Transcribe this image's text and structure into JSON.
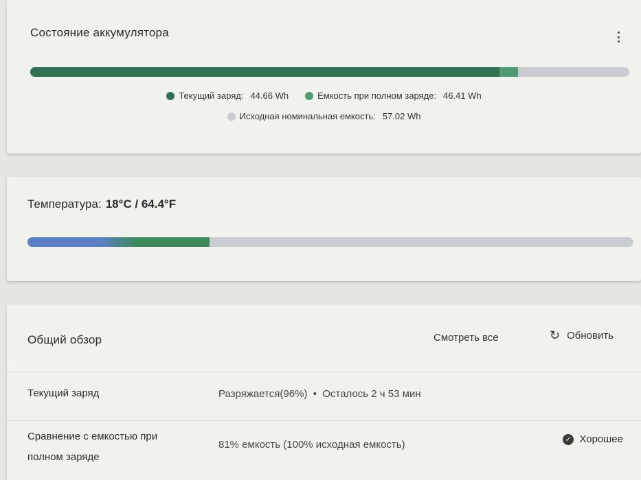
{
  "battery_health": {
    "title": "Состояние аккумулятора",
    "menu_icon": "more-vert-icon",
    "current_charge_wh": 44.66,
    "full_charge_capacity_wh": 46.41,
    "design_capacity_wh": 57.02,
    "colors": {
      "current": "#2f7150",
      "full": "#4f9a72",
      "design": "#c9cdd1"
    },
    "legend": [
      {
        "label": "Текущий заряд:",
        "value": "44.66 Wh"
      },
      {
        "label": "Емкость при полном заряде:",
        "value": "46.41 Wh"
      },
      {
        "label": "Исходная номинальная емкость:",
        "value": "57.02 Wh"
      }
    ]
  },
  "temperature": {
    "label": "Температура:",
    "value": "18°C / 64.4°F",
    "level_fraction": 0.3,
    "colors": {
      "cold": "#5b7fc4",
      "normal": "#3d8a5c",
      "track": "#c9cdd1"
    }
  },
  "overview": {
    "title": "Общий обзор",
    "view_all": "Смотреть все",
    "refresh": "Обновить",
    "refresh_icon": "refresh-icon",
    "rows": [
      {
        "label": "Текущий заряд",
        "value": "Разряжается(96%)  •  Осталось 2 ч 53 мин"
      },
      {
        "label_line1": "Сравнение с емкостью при",
        "label_line2": "полном заряде",
        "value": "81% емкость (100% исходная емкость)",
        "status": "Хорошее",
        "status_icon": "check-circle-icon"
      }
    ]
  }
}
